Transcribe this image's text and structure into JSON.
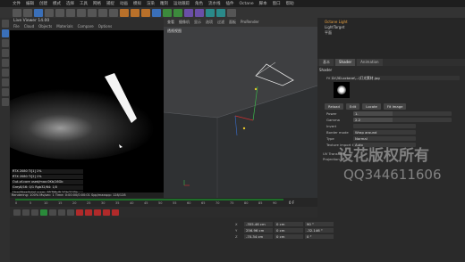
{
  "menubar": {
    "items": [
      "文件",
      "编辑",
      "创建",
      "模式",
      "选择",
      "工具",
      "网格",
      "捕捉",
      "动画",
      "模拟",
      "渲染",
      "雕刻",
      "运动跟踪",
      "角色",
      "流水线",
      "插件",
      "Octane",
      "脚本",
      "窗口",
      "帮助"
    ]
  },
  "live_viewer": {
    "title": "Live Viewer 14.00",
    "menu": [
      "File",
      "Cloud",
      "Objects",
      "Materials",
      "Compare",
      "Options"
    ],
    "stats": [
      "RTX 2080 Ti[1]      1%",
      "RTX 2080 Ti[2]      1%",
      "Out-of-core used/max:0Kb/16Gb",
      "Grey8/16: 0/1    Rgb32/64: 1/0",
      "Used/free/total vram: 957Mb/9.1Gb/11Gb"
    ],
    "bottom": "Rendering: 100%   Ms/sec: 1   Time: 0:00:00/0:00:01   Spp/maxspp: 128/128"
  },
  "viewport": {
    "label": "透视视图",
    "menu": [
      "查看",
      "摄像机",
      "显示",
      "选项",
      "过滤",
      "面板",
      "ProRender"
    ]
  },
  "right_panel": {
    "objects": [
      "Octane Light",
      "LightTarget",
      "平面"
    ],
    "tabs": [
      "基本",
      "Shader",
      "Animation"
    ],
    "section_title": "Shader",
    "texture_path": "D:\\3D-octane\\...\\灯光素材.jpg",
    "buttons": [
      "Reload",
      "Edit",
      "Locate",
      "Fit Image"
    ],
    "fields": [
      {
        "label": "Power",
        "value": "1."
      },
      {
        "label": "Gamma",
        "value": "2.2"
      },
      {
        "label": "Invert",
        "value": ""
      },
      {
        "label": "Border mode",
        "value": "Wrap around"
      },
      {
        "label": "Type",
        "value": "Normal"
      },
      {
        "label": "Texture import type",
        "value": "Auto"
      }
    ]
  },
  "timeline": {
    "ticks": [
      "0",
      "5",
      "10",
      "15",
      "20",
      "25",
      "30",
      "35",
      "40",
      "45",
      "50",
      "55",
      "60",
      "65",
      "70",
      "75",
      "80",
      "85",
      "90"
    ],
    "current_frame": "0 F"
  },
  "coords": [
    {
      "k": "X",
      "a": "-355.46 cm",
      "b": "0 cm",
      "c": "90 °"
    },
    {
      "k": "Y",
      "a": "256.96 cm",
      "b": "0 cm",
      "c": "-32.146 °"
    },
    {
      "k": "Z",
      "a": "-70.34 cm",
      "b": "0 cm",
      "c": "0 °"
    }
  ],
  "watermark": {
    "line1": "设花版权所有",
    "line2": "QQ344611606"
  }
}
